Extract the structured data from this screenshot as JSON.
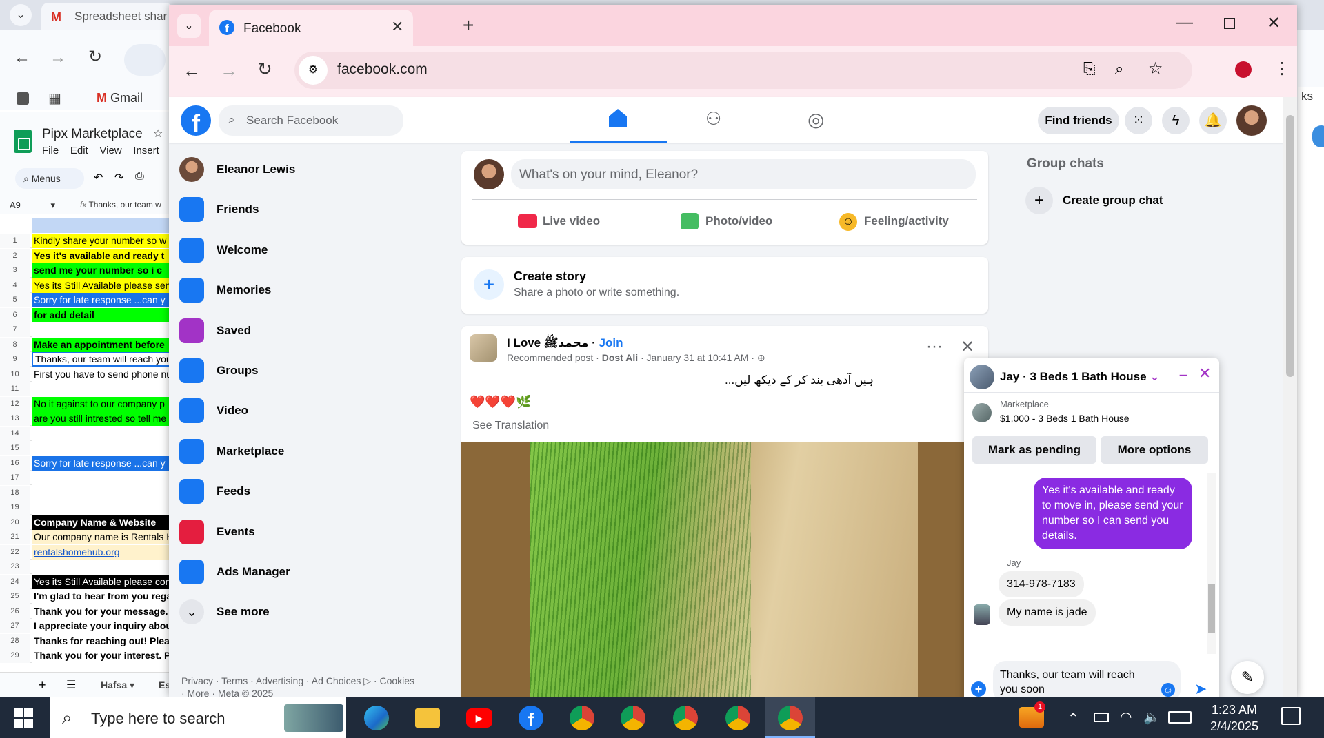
{
  "back_window": {
    "tab_title": "Spreadsheet shar",
    "bookmark": "Gmail",
    "sheet_title": "Pipx Marketplace",
    "menus": [
      "File",
      "Edit",
      "View",
      "Insert"
    ],
    "menus_search": "Menus",
    "cell_ref": "A9",
    "formula": "Thanks, our team w",
    "right_edge_text": "ks",
    "rows": [
      {
        "n": "1",
        "text": "Kindly share your number so w",
        "bg": "#ffff00",
        "bold": false
      },
      {
        "n": "2",
        "text": "Yes it's available and ready t",
        "bg": "#ffff00",
        "bold": true
      },
      {
        "n": "3",
        "text": "send me your number so i c",
        "bg": "#00ff00",
        "bold": true
      },
      {
        "n": "4",
        "text": "Yes its Still Available please send",
        "bg": "#ffff00",
        "bold": false
      },
      {
        "n": "5",
        "text": "Sorry for late response ...can y",
        "bg": "#1a73e8",
        "bold": false,
        "color": "#fff"
      },
      {
        "n": "6",
        "text": "for add detail",
        "bg": "#00ff00",
        "bold": true
      },
      {
        "n": "7",
        "text": "",
        "bg": "#fff",
        "bold": false
      },
      {
        "n": "8",
        "text": "Make an appointment before",
        "bg": "#00ff00",
        "bold": true
      },
      {
        "n": "9",
        "text": "Thanks, our team will reach you s",
        "bg": "#fff",
        "bold": false,
        "selected": true
      },
      {
        "n": "10",
        "text": "First you have to send phone nur",
        "bg": "#fff",
        "bold": false
      },
      {
        "n": "11",
        "text": "",
        "bg": "#fff",
        "bold": false
      },
      {
        "n": "12",
        "text": "No it against to our company p",
        "bg": "#00ff00",
        "bold": false
      },
      {
        "n": "13",
        "text": "are you still intrested so tell me C",
        "bg": "#00ff00",
        "bold": false
      },
      {
        "n": "14",
        "text": "",
        "bg": "#fff",
        "bold": false
      },
      {
        "n": "15",
        "text": "",
        "bg": "#fff",
        "bold": false
      },
      {
        "n": "16",
        "text": "Sorry for late response ...can y",
        "bg": "#1a73e8",
        "bold": false,
        "color": "#fff"
      },
      {
        "n": "17",
        "text": "",
        "bg": "#fff",
        "bold": false
      },
      {
        "n": "18",
        "text": "",
        "bg": "#fff",
        "bold": false
      },
      {
        "n": "19",
        "text": "",
        "bg": "#fff",
        "bold": false
      },
      {
        "n": "20",
        "text": "Company Name & Website",
        "bg": "#000",
        "bold": true,
        "color": "#fff"
      },
      {
        "n": "21",
        "text": "Our company name is Rentals Ho",
        "bg": "#fff2cc",
        "bold": false
      },
      {
        "n": "22",
        "text": "rentalshomehub.org",
        "bg": "#fff2cc",
        "bold": false,
        "color": "#1155cc",
        "underline": true
      },
      {
        "n": "23",
        "text": "",
        "bg": "#fff",
        "bold": false
      },
      {
        "n": "24",
        "text": "Yes its Still Available please cont",
        "bg": "#000",
        "bold": false,
        "color": "#fff"
      },
      {
        "n": "25",
        "text": "I'm glad to hear from you regar",
        "bg": "#fff",
        "bold": true
      },
      {
        "n": "26",
        "text": "Thank you for your message. F",
        "bg": "#fff",
        "bold": true
      },
      {
        "n": "27",
        "text": "I appreciate your inquiry about",
        "bg": "#fff",
        "bold": true
      },
      {
        "n": "28",
        "text": "Thanks for reaching out! Pleas",
        "bg": "#fff",
        "bold": true
      },
      {
        "n": "29",
        "text": "Thank you for your interest. Ple",
        "bg": "#fff",
        "bold": true
      }
    ],
    "sheet_tab": "Hafsa",
    "sheet_tab2": "Es"
  },
  "browser": {
    "tab_title": "Facebook",
    "url": "facebook.com"
  },
  "facebook": {
    "search_placeholder": "Search Facebook",
    "find_friends": "Find friends",
    "sidebar": [
      {
        "label": "Eleanor Lewis",
        "icon": "avatar",
        "color": "#6b4a3a"
      },
      {
        "label": "Friends",
        "icon": "friends-icon",
        "color": "#1877f2"
      },
      {
        "label": "Welcome",
        "icon": "facebook-logo-icon",
        "color": "#1877f2"
      },
      {
        "label": "Memories",
        "icon": "memories-clock-icon",
        "color": "#1877f2"
      },
      {
        "label": "Saved",
        "icon": "bookmark-icon",
        "color": "#a233c6"
      },
      {
        "label": "Groups",
        "icon": "groups-icon",
        "color": "#1877f2"
      },
      {
        "label": "Video",
        "icon": "video-play-icon",
        "color": "#1877f2"
      },
      {
        "label": "Marketplace",
        "icon": "marketplace-shop-icon",
        "color": "#1877f2"
      },
      {
        "label": "Feeds",
        "icon": "feeds-icon",
        "color": "#1877f2"
      },
      {
        "label": "Events",
        "icon": "events-calendar-icon",
        "color": "#e41e3f"
      },
      {
        "label": "Ads Manager",
        "icon": "ads-manager-chart-icon",
        "color": "#1877f2"
      },
      {
        "label": "See more",
        "icon": "chevron-down-icon",
        "color": "#050505"
      }
    ],
    "footer": "Privacy · Terms · Advertising · Ad Choices ▷ · Cookies",
    "footer2": "· More · Meta © 2025",
    "composer": {
      "placeholder": "What's on your mind, Eleanor?",
      "live": "Live video",
      "photo": "Photo/video",
      "feeling": "Feeling/activity"
    },
    "story": {
      "title": "Create story",
      "subtitle": "Share a photo or write something."
    },
    "post": {
      "page": "I Love محمدﷺ",
      "join": "Join",
      "meta_prefix": "Recommended post · ",
      "meta_author": "Dost Ali",
      "meta_time": " · January 31 at 10:41 AM · ",
      "urdu_text": "ہیں آدھی بند کر کے دیکھ لیں...",
      "emojis": "❤️❤️❤️🌿",
      "translation": "See Translation"
    },
    "group_chats": {
      "title": "Group chats",
      "create": "Create group chat"
    },
    "chat": {
      "title": "Jay · 3 Beds 1 Bath House",
      "listing_label": "Marketplace",
      "listing": "$1,000 - 3 Beds 1 Bath House",
      "btn_pending": "Mark as pending",
      "btn_more": "More options",
      "msg_out": "Yes it's available and ready to move in, please send your number so I can send you details.",
      "sender": "Jay",
      "msg_in1": "314-978-7183",
      "msg_in2": "My name is jade",
      "draft": "Thanks, our team will reach you soon"
    }
  },
  "taskbar": {
    "search_placeholder": "Type here to search",
    "time": "1:23 AM",
    "date": "2/4/2025",
    "badge": "1"
  }
}
